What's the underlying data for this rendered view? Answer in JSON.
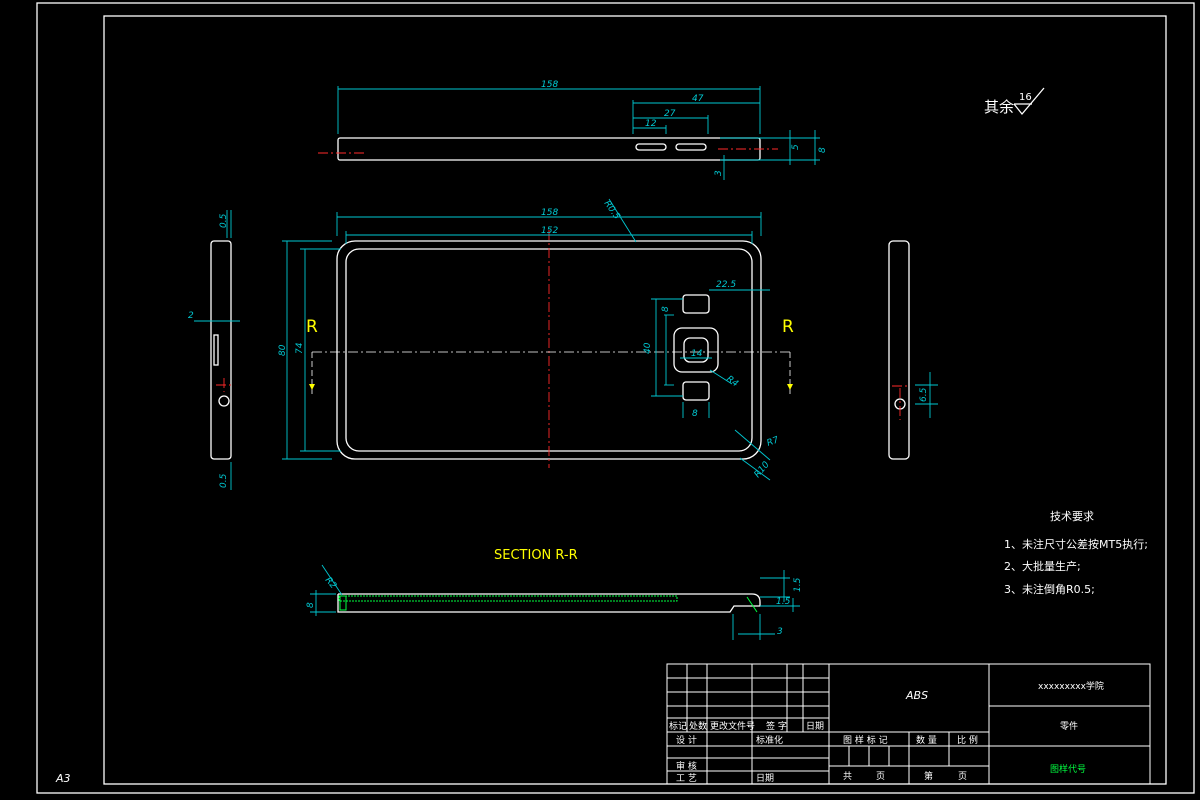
{
  "colors": {
    "background": "#000000",
    "outline": "#ffffff",
    "dimension": "#00c8d2",
    "centerline": "#ff2a2a",
    "title_text": "#ffff00",
    "hatch": "#00ff40"
  },
  "sheet_size": "A3",
  "roughness": {
    "label": "其余",
    "value": "16"
  },
  "section_title": "SECTION R-R",
  "section_marks": [
    "R",
    "R"
  ],
  "top_view_dims": {
    "overall": "158",
    "d47": "47",
    "d27": "27",
    "d12": "12",
    "d5": "5",
    "d8": "8",
    "d3": "3"
  },
  "front_view_dims": {
    "d158": "158",
    "d152": "152",
    "radius_top": "R0.5",
    "d80": "80",
    "d74": "74",
    "d22_5": "22.5",
    "d8a": "8",
    "d8b": "8",
    "d40": "40",
    "d14": "14",
    "r4": "R4",
    "r7": "R7",
    "r10": "R10"
  },
  "side_view_dims": {
    "d0_5_top": "0.5",
    "d2": "2",
    "d0_5_bot": "0.5",
    "d6_5": "6.5"
  },
  "section_dims": {
    "r2": "R2",
    "d8": "8",
    "d1_5a": "1.5",
    "d1_5b": "1.5",
    "d3": "3"
  },
  "tech_requirements": {
    "title": "技术要求",
    "items": [
      "1、未注尺寸公差按MT5执行;",
      "2、大批量生产;",
      "3、未注倒角R0.5;"
    ]
  },
  "title_block": {
    "material": "ABS",
    "school": "xxxxxxxxx学院",
    "part_name": "零件",
    "drawing_code": "图样代号",
    "labels": {
      "mark": "标记",
      "count": "处数",
      "change_doc": "更改文件号",
      "signature": "签 字",
      "date": "日期",
      "design": "设 计",
      "standardize": "标准化",
      "review": "审 核",
      "craft": "工 艺",
      "date2": "日期",
      "pattern_mark": "图 样 标 记",
      "quantity": "数 量",
      "scale": "比 例",
      "total": "共",
      "sheets": "页",
      "sheet_no": "第",
      "sheets2": "页"
    }
  }
}
